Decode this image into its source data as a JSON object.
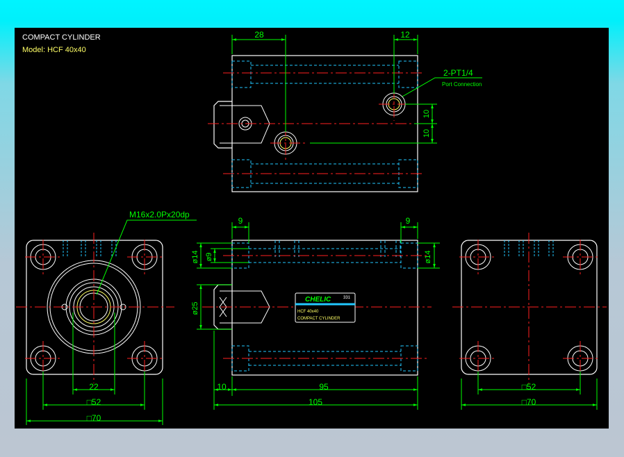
{
  "title": {
    "line1": "COMPACT CYLINDER",
    "line2": "Model:  HCF  40x40"
  },
  "colors": {
    "background": "#000000",
    "outline": "#ffffff",
    "hidden": "#22c8ff",
    "centerline": "#ff2020",
    "dimension": "#00ff00"
  },
  "top_view": {
    "dim_28": "28",
    "dim_12": "12",
    "dim_10a": "10",
    "dim_10b": "10",
    "port_label": "2-PT1/4",
    "port_sub": "Port Connection"
  },
  "front_view": {
    "thread_label": "M16x2.0Px20dp",
    "dim_22": "22",
    "dim_sq52": "□52",
    "dim_sq70": "□70"
  },
  "side_view": {
    "dim_9a": "9",
    "dim_9b": "9",
    "dim_phi14a": "ø14",
    "dim_phi9": "ø9",
    "dim_phi14b": "ø14",
    "dim_phi25": "ø25",
    "dim_10": "10",
    "dim_95": "95",
    "dim_105": "105"
  },
  "nameplate": {
    "brand": "CHELIC",
    "code": "331",
    "model": "HCF 40x40",
    "desc": "COMPACT CYLINDER"
  },
  "rear_view": {
    "dim_sq52": "□52",
    "dim_sq70": "□70"
  }
}
